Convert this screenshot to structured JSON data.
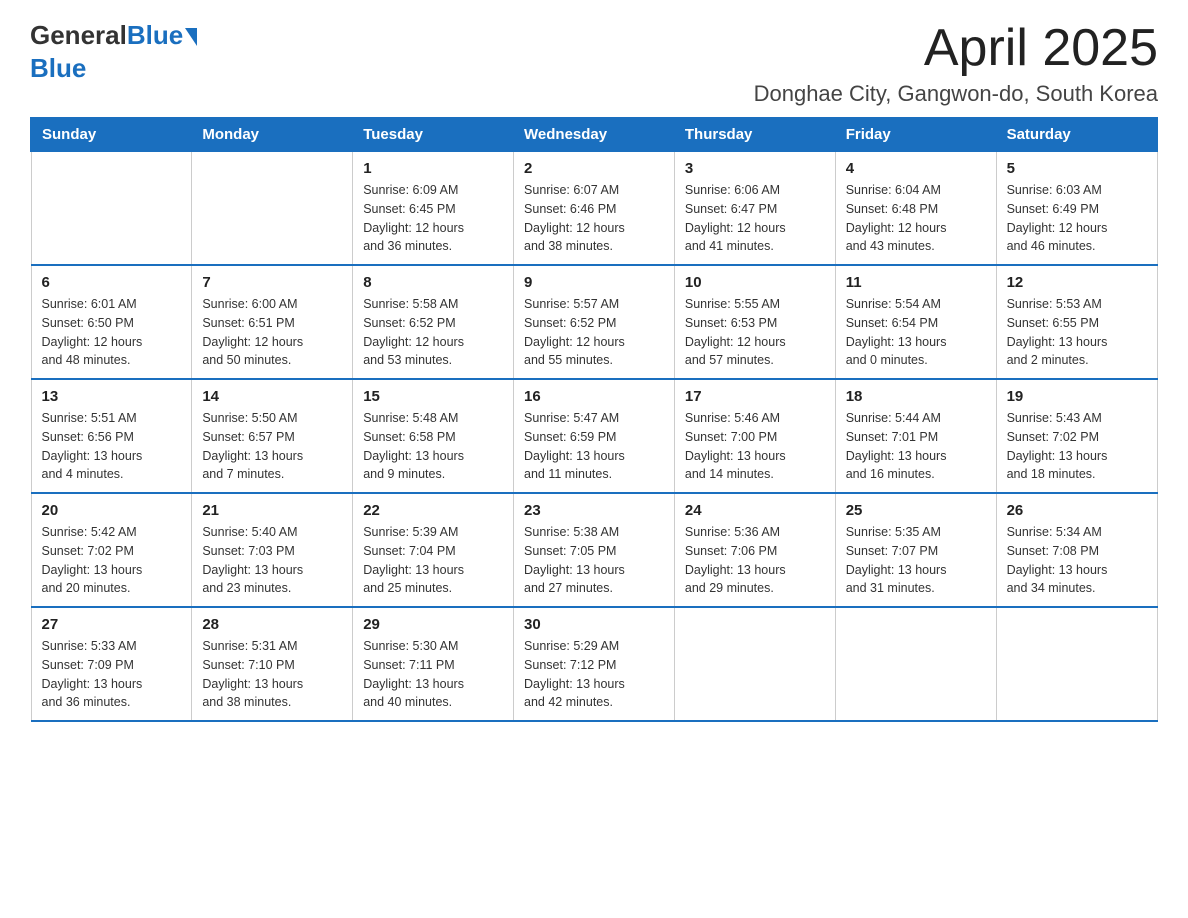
{
  "header": {
    "logo_general": "General",
    "logo_blue": "Blue",
    "month_title": "April 2025",
    "subtitle": "Donghae City, Gangwon-do, South Korea"
  },
  "weekdays": [
    "Sunday",
    "Monday",
    "Tuesday",
    "Wednesday",
    "Thursday",
    "Friday",
    "Saturday"
  ],
  "weeks": [
    [
      {
        "day": "",
        "info": ""
      },
      {
        "day": "",
        "info": ""
      },
      {
        "day": "1",
        "info": "Sunrise: 6:09 AM\nSunset: 6:45 PM\nDaylight: 12 hours\nand 36 minutes."
      },
      {
        "day": "2",
        "info": "Sunrise: 6:07 AM\nSunset: 6:46 PM\nDaylight: 12 hours\nand 38 minutes."
      },
      {
        "day": "3",
        "info": "Sunrise: 6:06 AM\nSunset: 6:47 PM\nDaylight: 12 hours\nand 41 minutes."
      },
      {
        "day": "4",
        "info": "Sunrise: 6:04 AM\nSunset: 6:48 PM\nDaylight: 12 hours\nand 43 minutes."
      },
      {
        "day": "5",
        "info": "Sunrise: 6:03 AM\nSunset: 6:49 PM\nDaylight: 12 hours\nand 46 minutes."
      }
    ],
    [
      {
        "day": "6",
        "info": "Sunrise: 6:01 AM\nSunset: 6:50 PM\nDaylight: 12 hours\nand 48 minutes."
      },
      {
        "day": "7",
        "info": "Sunrise: 6:00 AM\nSunset: 6:51 PM\nDaylight: 12 hours\nand 50 minutes."
      },
      {
        "day": "8",
        "info": "Sunrise: 5:58 AM\nSunset: 6:52 PM\nDaylight: 12 hours\nand 53 minutes."
      },
      {
        "day": "9",
        "info": "Sunrise: 5:57 AM\nSunset: 6:52 PM\nDaylight: 12 hours\nand 55 minutes."
      },
      {
        "day": "10",
        "info": "Sunrise: 5:55 AM\nSunset: 6:53 PM\nDaylight: 12 hours\nand 57 minutes."
      },
      {
        "day": "11",
        "info": "Sunrise: 5:54 AM\nSunset: 6:54 PM\nDaylight: 13 hours\nand 0 minutes."
      },
      {
        "day": "12",
        "info": "Sunrise: 5:53 AM\nSunset: 6:55 PM\nDaylight: 13 hours\nand 2 minutes."
      }
    ],
    [
      {
        "day": "13",
        "info": "Sunrise: 5:51 AM\nSunset: 6:56 PM\nDaylight: 13 hours\nand 4 minutes."
      },
      {
        "day": "14",
        "info": "Sunrise: 5:50 AM\nSunset: 6:57 PM\nDaylight: 13 hours\nand 7 minutes."
      },
      {
        "day": "15",
        "info": "Sunrise: 5:48 AM\nSunset: 6:58 PM\nDaylight: 13 hours\nand 9 minutes."
      },
      {
        "day": "16",
        "info": "Sunrise: 5:47 AM\nSunset: 6:59 PM\nDaylight: 13 hours\nand 11 minutes."
      },
      {
        "day": "17",
        "info": "Sunrise: 5:46 AM\nSunset: 7:00 PM\nDaylight: 13 hours\nand 14 minutes."
      },
      {
        "day": "18",
        "info": "Sunrise: 5:44 AM\nSunset: 7:01 PM\nDaylight: 13 hours\nand 16 minutes."
      },
      {
        "day": "19",
        "info": "Sunrise: 5:43 AM\nSunset: 7:02 PM\nDaylight: 13 hours\nand 18 minutes."
      }
    ],
    [
      {
        "day": "20",
        "info": "Sunrise: 5:42 AM\nSunset: 7:02 PM\nDaylight: 13 hours\nand 20 minutes."
      },
      {
        "day": "21",
        "info": "Sunrise: 5:40 AM\nSunset: 7:03 PM\nDaylight: 13 hours\nand 23 minutes."
      },
      {
        "day": "22",
        "info": "Sunrise: 5:39 AM\nSunset: 7:04 PM\nDaylight: 13 hours\nand 25 minutes."
      },
      {
        "day": "23",
        "info": "Sunrise: 5:38 AM\nSunset: 7:05 PM\nDaylight: 13 hours\nand 27 minutes."
      },
      {
        "day": "24",
        "info": "Sunrise: 5:36 AM\nSunset: 7:06 PM\nDaylight: 13 hours\nand 29 minutes."
      },
      {
        "day": "25",
        "info": "Sunrise: 5:35 AM\nSunset: 7:07 PM\nDaylight: 13 hours\nand 31 minutes."
      },
      {
        "day": "26",
        "info": "Sunrise: 5:34 AM\nSunset: 7:08 PM\nDaylight: 13 hours\nand 34 minutes."
      }
    ],
    [
      {
        "day": "27",
        "info": "Sunrise: 5:33 AM\nSunset: 7:09 PM\nDaylight: 13 hours\nand 36 minutes."
      },
      {
        "day": "28",
        "info": "Sunrise: 5:31 AM\nSunset: 7:10 PM\nDaylight: 13 hours\nand 38 minutes."
      },
      {
        "day": "29",
        "info": "Sunrise: 5:30 AM\nSunset: 7:11 PM\nDaylight: 13 hours\nand 40 minutes."
      },
      {
        "day": "30",
        "info": "Sunrise: 5:29 AM\nSunset: 7:12 PM\nDaylight: 13 hours\nand 42 minutes."
      },
      {
        "day": "",
        "info": ""
      },
      {
        "day": "",
        "info": ""
      },
      {
        "day": "",
        "info": ""
      }
    ]
  ]
}
